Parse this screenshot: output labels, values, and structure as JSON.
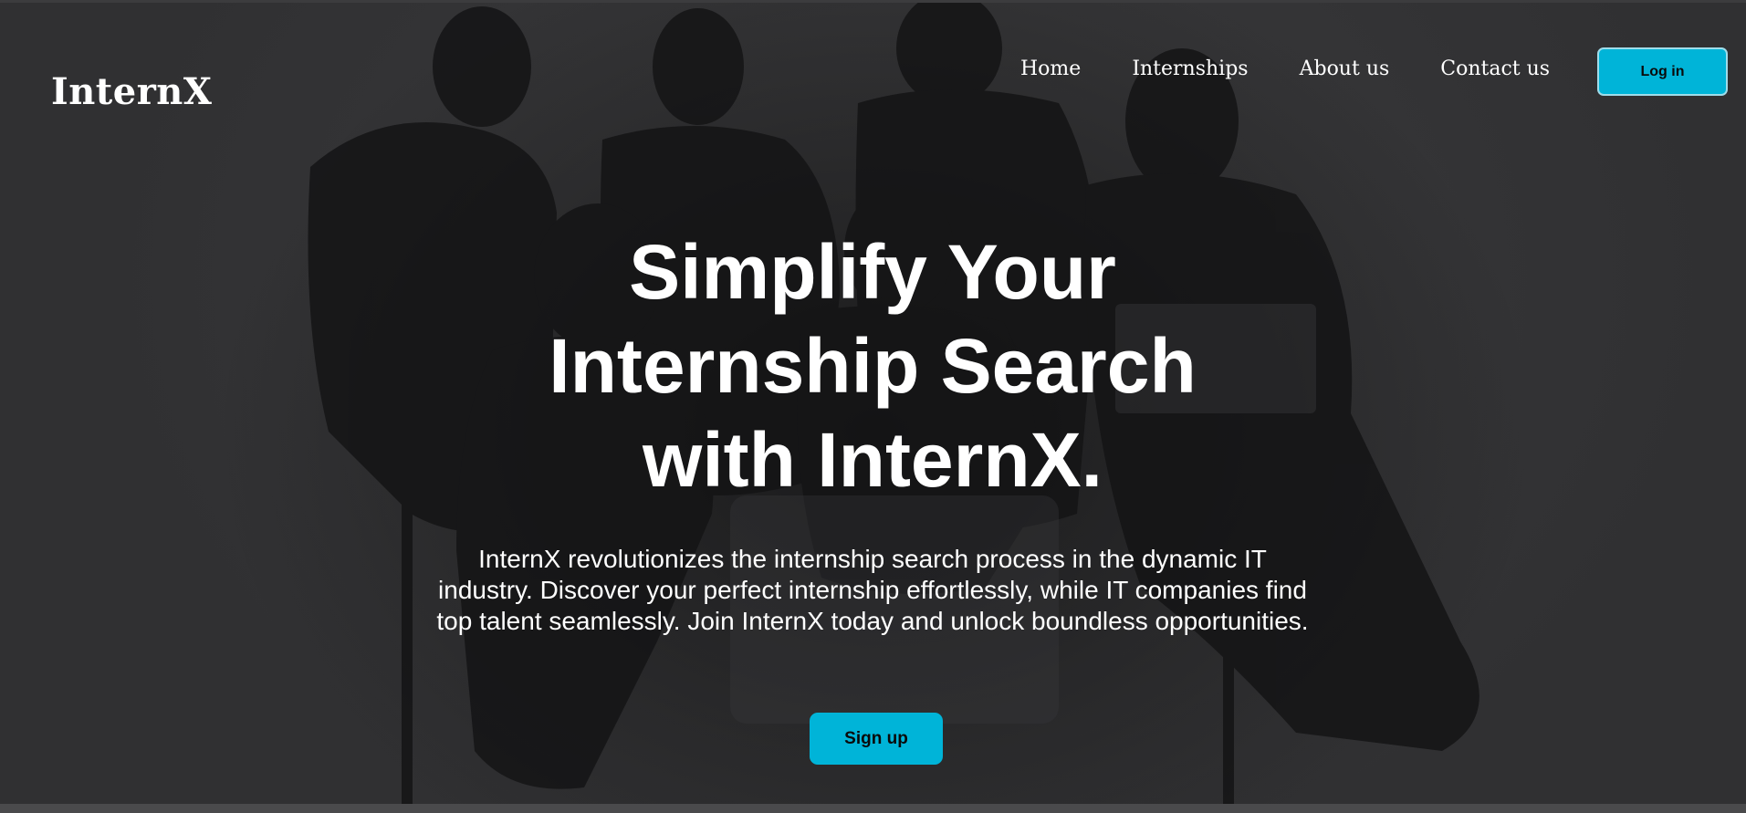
{
  "header": {
    "logo_text": "InternX",
    "nav": [
      {
        "label": "Home"
      },
      {
        "label": "Internships"
      },
      {
        "label": "About us"
      },
      {
        "label": "Contact us"
      }
    ],
    "login_label": "Log in"
  },
  "hero": {
    "headline_lines": [
      "Simplify Your",
      "Internship Search",
      "with InternX."
    ],
    "description": "InternX revolutionizes the internship search process in the dynamic IT industry. Discover your perfect internship effortlessly, while IT companies find top talent seamlessly. Join InternX today and unlock boundless opportunities.",
    "signup_label": "Sign up",
    "background_image": "group-of-young-people-photo"
  },
  "colors": {
    "accent": "#00b4d8",
    "text": "#ffffff",
    "overlay": "#2a2a2b"
  }
}
